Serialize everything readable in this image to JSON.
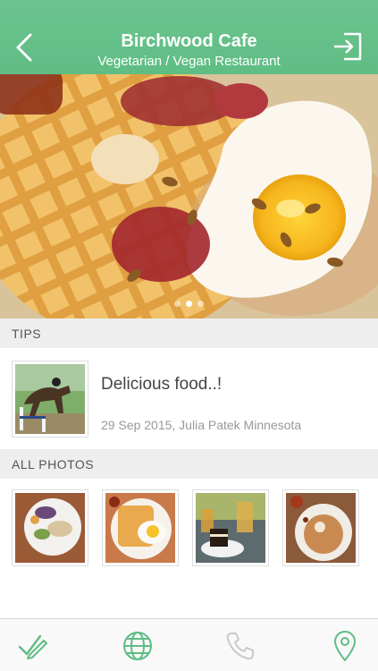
{
  "header": {
    "title": "Birchwood Cafe",
    "subtitle": "Vegetarian / Vegan Restaurant",
    "back_icon": "chevron-left-icon",
    "signin_icon": "sign-in-icon"
  },
  "hero": {
    "image": "waffle-with-fried-egg-photo",
    "dots_count": 3,
    "active_dot": 1
  },
  "tips": {
    "header": "TIPS",
    "items": [
      {
        "thumb": "horse-jumping-photo",
        "text": "Delicious food..!",
        "meta": "29 Sep 2015, Julia Patek Minnesota"
      }
    ]
  },
  "photos": {
    "header": "ALL PHOTOS",
    "items": [
      {
        "name": "plate-salad-photo"
      },
      {
        "name": "waffle-egg-photo"
      },
      {
        "name": "cake-and-drinks-photo"
      },
      {
        "name": "pancake-plate-photo"
      }
    ]
  },
  "tabbar": {
    "items": [
      {
        "icon": "check-in-icon",
        "enabled": true
      },
      {
        "icon": "globe-icon",
        "enabled": true
      },
      {
        "icon": "phone-icon",
        "enabled": false
      },
      {
        "icon": "map-pin-icon",
        "enabled": true
      }
    ]
  },
  "colors": {
    "accent": "#5fbd84",
    "section_bg": "#eeeeee",
    "disabled_icon": "#c9c9c9"
  }
}
